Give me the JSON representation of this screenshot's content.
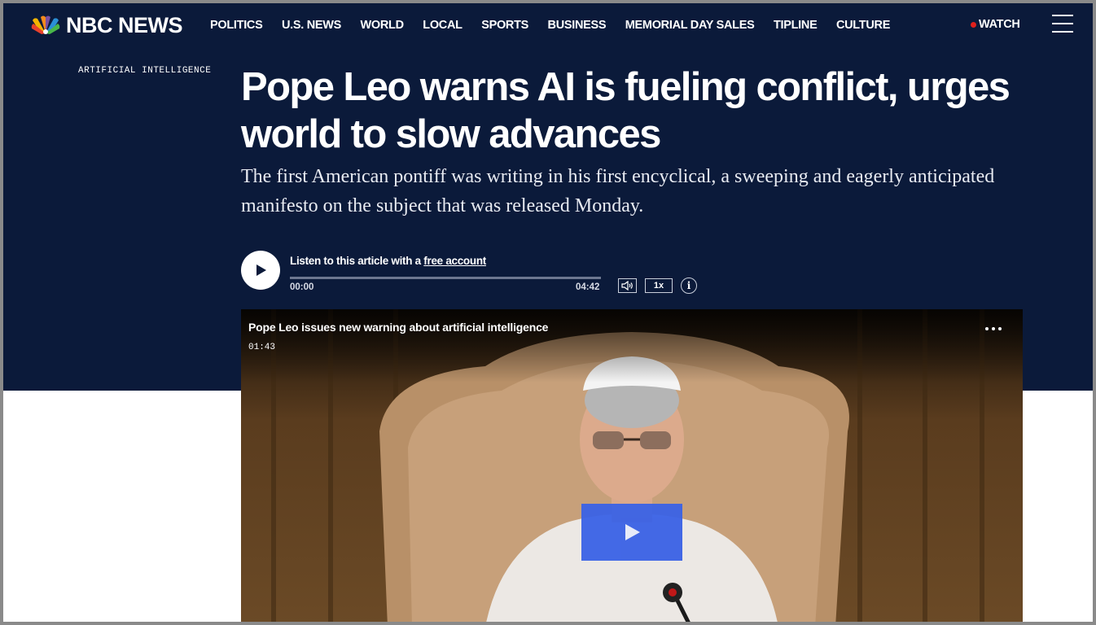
{
  "brand": {
    "name": "NBC NEWS"
  },
  "nav": {
    "links": [
      "POLITICS",
      "U.S. NEWS",
      "WORLD",
      "LOCAL",
      "SPORTS",
      "BUSINESS",
      "MEMORIAL DAY SALES",
      "TIPLINE",
      "CULTURE"
    ],
    "watch_label": "WATCH"
  },
  "article": {
    "section": "ARTIFICIAL INTELLIGENCE",
    "headline": "Pope Leo warns AI is fueling conflict, urges world to slow advances",
    "dek": "The first American pontiff was writing in his first encyclical, a sweeping and eagerly anticipated manifesto on the subject that was released Monday."
  },
  "audio": {
    "prompt": "Listen to this article with a",
    "link_label": "free account",
    "current_time": "00:00",
    "duration": "04:42",
    "progress": 0.0,
    "speed": "1x"
  },
  "video": {
    "title": "Pope Leo issues new warning about artificial intelligence",
    "duration": "01:43"
  },
  "colors": {
    "header_bg": "#0b1a3a",
    "live_dot": "#e0201c",
    "video_play": "#3a62e6"
  },
  "icons": [
    "peacock-logo-icon",
    "live-dot-icon",
    "hamburger-menu-icon",
    "play-icon",
    "volume-icon",
    "info-icon",
    "more-options-icon"
  ]
}
